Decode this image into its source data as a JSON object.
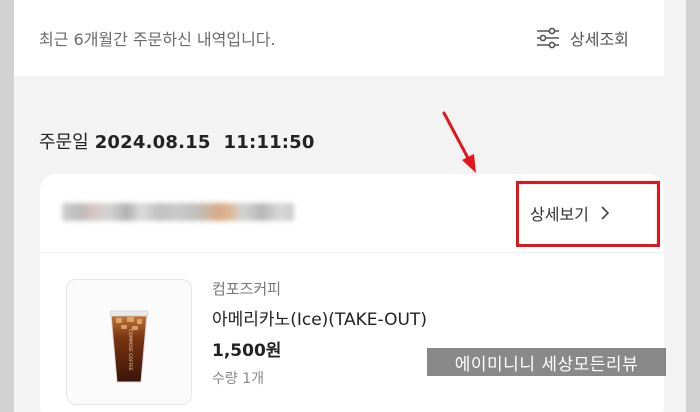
{
  "header": {
    "notice": "최근 6개월간 주문하신 내역입니다.",
    "filter_label": "상세조회",
    "filter_icon": "sliders-icon"
  },
  "order": {
    "date_label": "주문일",
    "date_value": "2024.08.15  11:11:50",
    "detail_label": "상세보기",
    "detail_icon": "chevron-right-icon",
    "item": {
      "brand": "컴포즈커피",
      "name": "아메리카노(Ice)(TAKE-OUT)",
      "price": "1,500원",
      "quantity": "수량 1개",
      "cup_text": "COMPOSE COFFEE"
    }
  },
  "annotation": {
    "arrow_color": "#e3141a",
    "box_color": "#e3141a"
  },
  "watermark": "에이미니니 세상모든리뷰"
}
